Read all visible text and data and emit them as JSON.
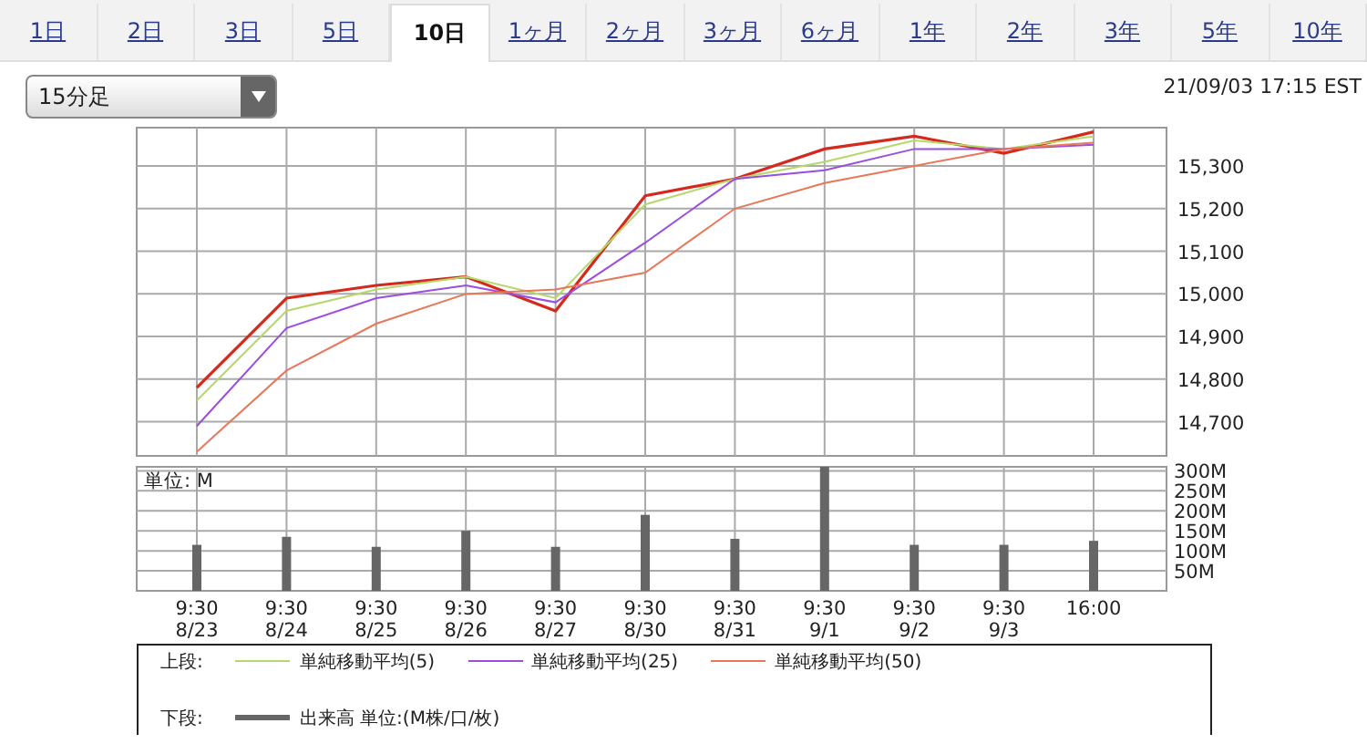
{
  "tabs": [
    {
      "label": "1日",
      "selected": false
    },
    {
      "label": "2日",
      "selected": false
    },
    {
      "label": "3日",
      "selected": false
    },
    {
      "label": "5日",
      "selected": false
    },
    {
      "label": "10日",
      "selected": true
    },
    {
      "label": "1ヶ月",
      "selected": false
    },
    {
      "label": "2ヶ月",
      "selected": false
    },
    {
      "label": "3ヶ月",
      "selected": false
    },
    {
      "label": "6ヶ月",
      "selected": false
    },
    {
      "label": "1年",
      "selected": false
    },
    {
      "label": "2年",
      "selected": false
    },
    {
      "label": "3年",
      "selected": false
    },
    {
      "label": "5年",
      "selected": false
    },
    {
      "label": "10年",
      "selected": false
    }
  ],
  "interval_select": {
    "value": "15分足"
  },
  "timestamp": "21/09/03 17:15 EST",
  "price_chart": {
    "chart_data": {
      "type": "line",
      "grid": true,
      "ylim": [
        14620,
        15390
      ],
      "yticks": [
        {
          "value": 14700,
          "label": "14,700"
        },
        {
          "value": 14800,
          "label": "14,800"
        },
        {
          "value": 14900,
          "label": "14,900"
        },
        {
          "value": 15000,
          "label": "15,000"
        },
        {
          "value": 15100,
          "label": "15,100"
        },
        {
          "value": 15200,
          "label": "15,200"
        },
        {
          "value": 15300,
          "label": "15,300"
        }
      ],
      "series": [
        {
          "color": "#d42a1e",
          "values": [
            14780,
            14990,
            15020,
            15040,
            14960,
            15230,
            15270,
            15340,
            15370,
            15330,
            15380
          ]
        },
        {
          "name": "単純移動平均(5)",
          "color": "#b5d86a",
          "values": [
            14750,
            14960,
            15010,
            15040,
            14990,
            15210,
            15270,
            15310,
            15360,
            15340,
            15370
          ]
        },
        {
          "name": "単純移動平均(25)",
          "color": "#9b4de0",
          "values": [
            14690,
            14920,
            14990,
            15020,
            14980,
            15120,
            15270,
            15290,
            15340,
            15340,
            15350
          ]
        },
        {
          "name": "単純移動平均(50)",
          "color": "#e8775a",
          "values": [
            14630,
            14820,
            14930,
            15000,
            15010,
            15050,
            15200,
            15260,
            15300,
            15340,
            15355
          ]
        }
      ]
    }
  },
  "volume_chart": {
    "chart_data": {
      "type": "bar",
      "grid": true,
      "ylabel": "単位: M",
      "categories": [
        "9:30 8/23",
        "9:30 8/24",
        "9:30 8/25",
        "9:30 8/26",
        "9:30 8/27",
        "9:30 8/30",
        "9:30 8/31",
        "9:30 9/1",
        "9:30 9/2",
        "9:30 9/3",
        "16:00"
      ],
      "ylim": [
        0,
        310
      ],
      "yticks": [
        {
          "value": 50,
          "label": "50M"
        },
        {
          "value": 100,
          "label": "100M"
        },
        {
          "value": 150,
          "label": "150M"
        },
        {
          "value": 200,
          "label": "200M"
        },
        {
          "value": 250,
          "label": "250M"
        },
        {
          "value": 300,
          "label": "300M"
        }
      ],
      "series": [
        {
          "name": "出来高 単位:(M株/口/枚)",
          "color": "#666666",
          "values": [
            115,
            135,
            110,
            150,
            110,
            190,
            130,
            310,
            115,
            115,
            125
          ]
        }
      ]
    }
  },
  "legend": {
    "upper_label": "上段:",
    "lower_label": "下段:"
  }
}
